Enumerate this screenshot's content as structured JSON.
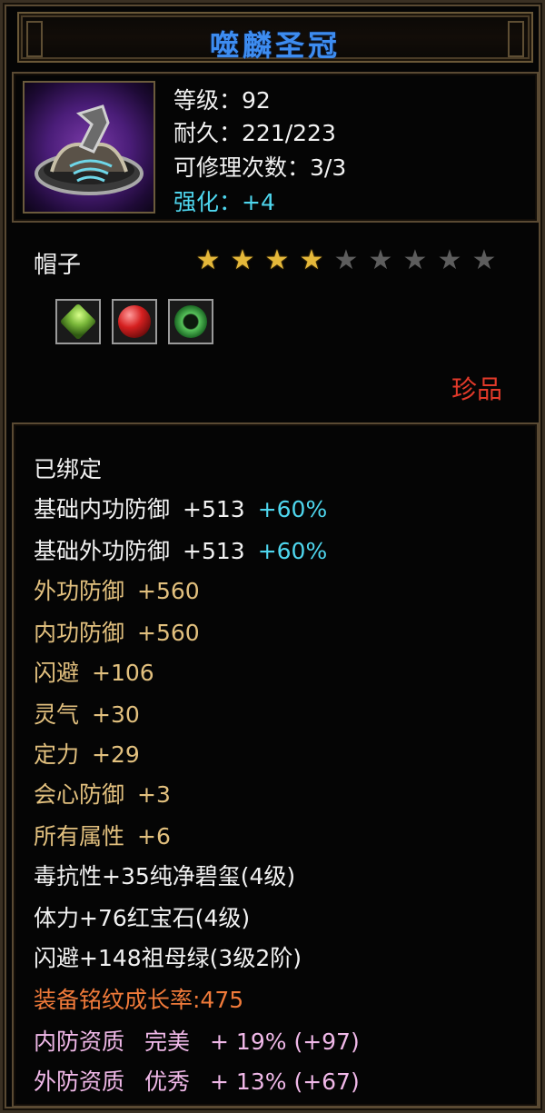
{
  "item": {
    "name": "噬麟圣冠",
    "icon": "crown-helmet-icon",
    "type": "帽子",
    "rarity": "珍品",
    "stars_filled": 4,
    "stars_total": 9
  },
  "stats": {
    "level_label": "等级：",
    "level": "92",
    "durability_label": "耐久：",
    "durability": "221/223",
    "repair_label": "可修理次数：",
    "repair": "3/3",
    "enhance_label": "强化：",
    "enhance": "+4"
  },
  "gems": [
    {
      "name": "green-gem-icon",
      "color": "#7ab83a"
    },
    {
      "name": "red-gem-icon",
      "color": "#d52020"
    },
    {
      "name": "jade-ring-gem-icon",
      "color": "#57c25a"
    }
  ],
  "properties": {
    "bound": "已绑定",
    "base_inner_def": {
      "label": "基础内功防御",
      "value": "+513",
      "pct": "+60%"
    },
    "base_outer_def": {
      "label": "基础外功防御",
      "value": "+513",
      "pct": "+60%"
    },
    "outer_def": {
      "label": "外功防御",
      "value": "+560"
    },
    "inner_def": {
      "label": "内功防御",
      "value": "+560"
    },
    "dodge": {
      "label": "闪避",
      "value": "+106"
    },
    "spirit": {
      "label": "灵气",
      "value": "+30"
    },
    "focus": {
      "label": "定力",
      "value": "+29"
    },
    "crit_def": {
      "label": "会心防御",
      "value": "+3"
    },
    "all_attr": {
      "label": "所有属性",
      "value": "+6"
    },
    "gem_line_1": "毒抗性+35纯净碧玺(4级)",
    "gem_line_2": "体力+76红宝石(4级)",
    "gem_line_3": "闪避+148祖母绿(3级2阶)",
    "growth": "装备铭纹成长率:475",
    "inner_quality": {
      "label": "内防资质",
      "grade": "完美",
      "value": "+ 19% (+97)"
    },
    "outer_quality": {
      "label": "外防资质",
      "grade": "优秀",
      "value": "+ 13% (+67)"
    }
  },
  "colors": {
    "title": "#3d8cf0",
    "enhance": "#4ed6ee",
    "gold_text": "#e2c07e",
    "rarity": "#e23a2a",
    "growth": "#f07a3a",
    "quality": "#f0b8e8",
    "star_on": "#e5b83a",
    "star_off": "#5d5d5d"
  }
}
